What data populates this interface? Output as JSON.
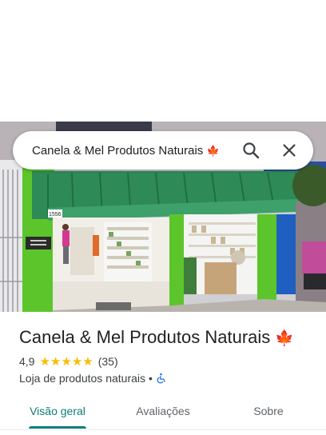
{
  "search": {
    "query": "Canela & Mel Produtos Naturais",
    "emoji": "🍁"
  },
  "place": {
    "name": "Canela & Mel Produtos Naturais",
    "emoji": "🍁",
    "rating": "4,9",
    "stars": 5,
    "reviews": "(35)",
    "category": "Loja de produtos naturais",
    "separator": "•"
  },
  "storefront": {
    "number": "1556"
  },
  "tabs": [
    {
      "label": "Visão geral",
      "active": true
    },
    {
      "label": "Avaliações",
      "active": false
    },
    {
      "label": "Sobre",
      "active": false
    }
  ],
  "colors": {
    "accent": "#0b7d7d",
    "star": "#fbbc04",
    "awning": "#2e8b57",
    "wall": "#5cc52b",
    "blue_column": "#1f5fbf"
  },
  "icons": [
    "search-icon",
    "close-icon",
    "wheelchair-icon",
    "star-icon",
    "maple-leaf-icon"
  ]
}
